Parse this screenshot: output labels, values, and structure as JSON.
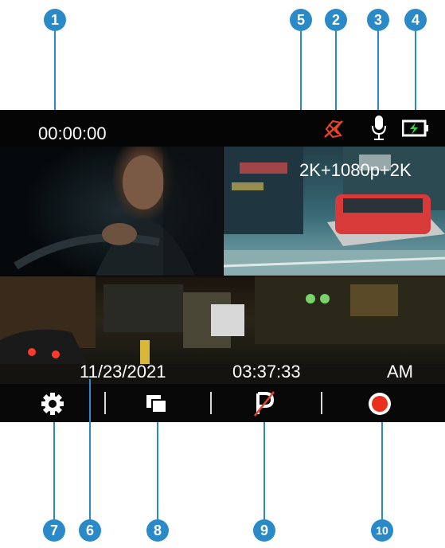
{
  "callouts": {
    "c1": "1",
    "c2": "2",
    "c3": "3",
    "c4": "4",
    "c5": "5",
    "c6": "6",
    "c7": "7",
    "c8": "8",
    "c9": "9",
    "c10": "10"
  },
  "status": {
    "recording_time": "00:00:00"
  },
  "video": {
    "resolution": "2K+1080p+2K"
  },
  "overlay": {
    "date": "11/23/2021",
    "time": "03:37:33",
    "ampm": "AM"
  },
  "icons": {
    "gps": "gps-off-icon",
    "mic": "microphone-icon",
    "battery": "battery-charging-icon",
    "settings": "settings-gear-icon",
    "view": "view-switch-icon",
    "parking": "parking-mode-off-icon",
    "record": "record-icon"
  },
  "colors": {
    "callout": "#2a8ac8",
    "alert": "#e8452a",
    "record": "#e8301c"
  }
}
